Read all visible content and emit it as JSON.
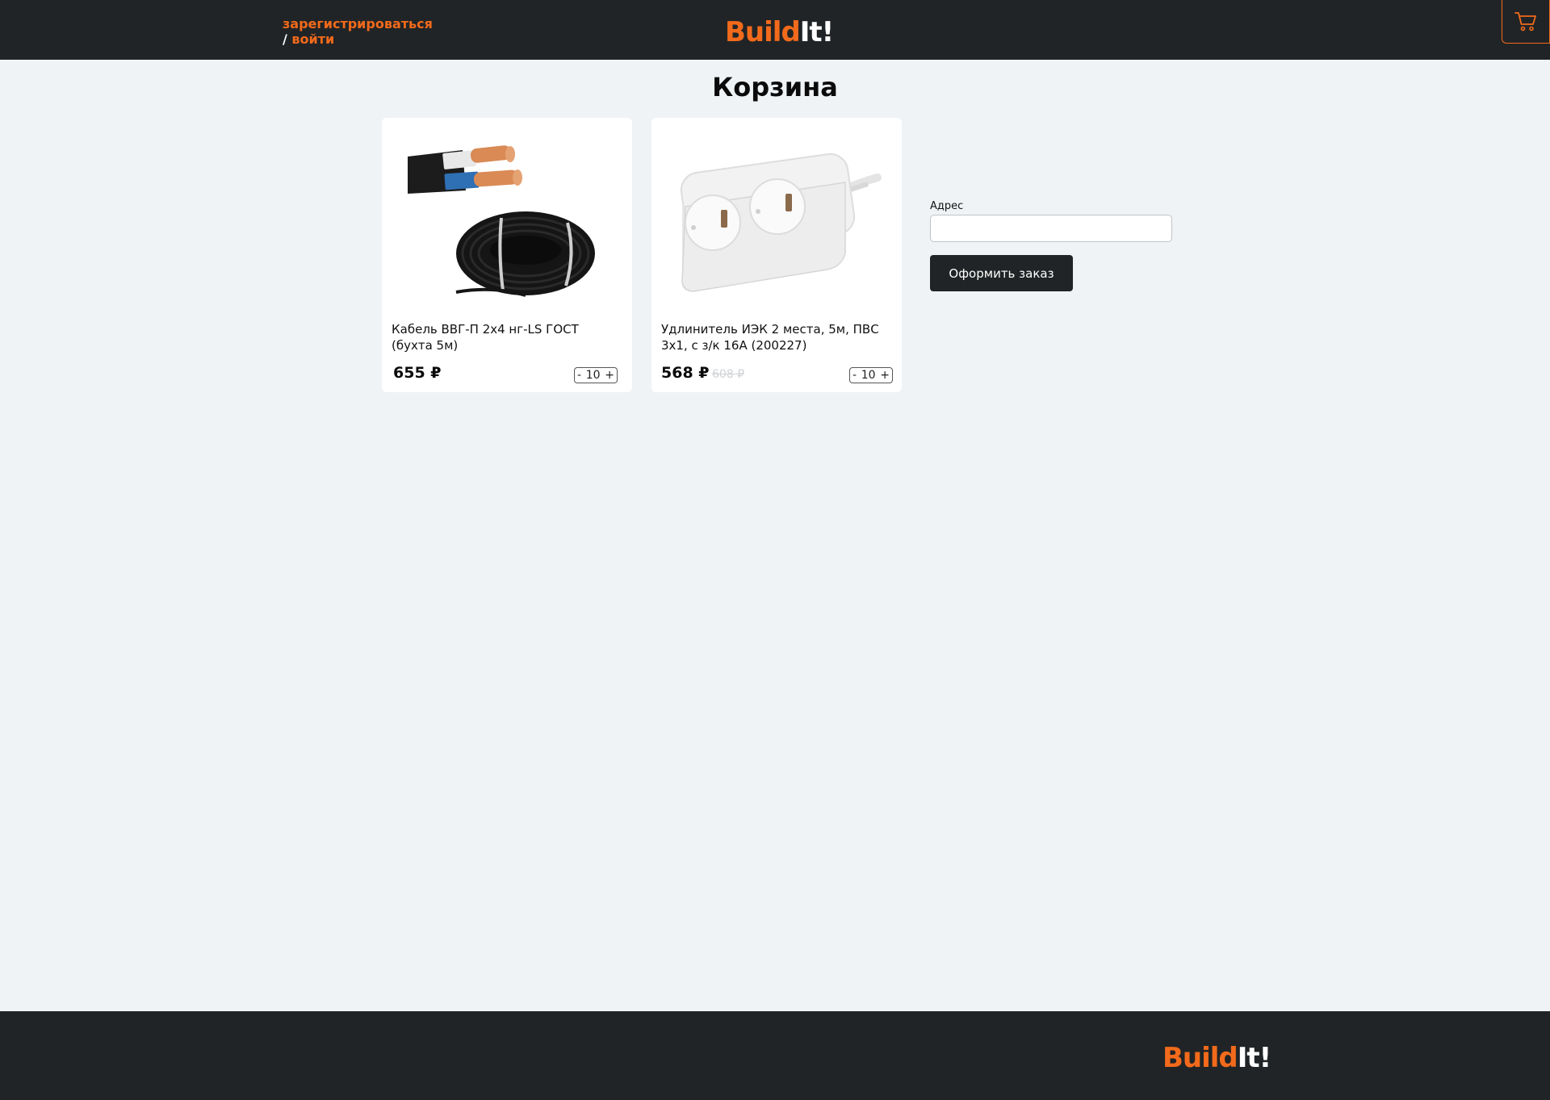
{
  "header": {
    "register_link": "зарегистрироваться",
    "slash": "/",
    "login_link": "войти",
    "logo_part1": "Build",
    "logo_part2": "It!",
    "cart_icon": "shopping-cart-icon"
  },
  "page": {
    "title": "Корзина"
  },
  "cart_items": [
    {
      "name": "Кабель ВВГ-П 2х4 нг-LS ГОСТ (бухта 5м)",
      "price": "655 ₽",
      "old_price": "",
      "qty_minus": "-",
      "qty": "10",
      "qty_plus": "+",
      "image_icon": "cable-coil-image"
    },
    {
      "name": "Удлинитель ИЭК 2 места, 5м, ПВС 3х1, с з/к 16А (200227)",
      "price": "568 ₽",
      "old_price": "608 ₽",
      "qty_minus": "-",
      "qty": "10",
      "qty_plus": "+",
      "image_icon": "power-strip-image"
    }
  ],
  "order_form": {
    "address_label": "Адрес",
    "address_value": "",
    "submit_label": "Оформить заказ"
  },
  "footer": {
    "logo_part1": "Build",
    "logo_part2": "It!"
  },
  "colors": {
    "accent": "#f26a1b",
    "dark": "#212426",
    "background": "#eff3f6"
  }
}
